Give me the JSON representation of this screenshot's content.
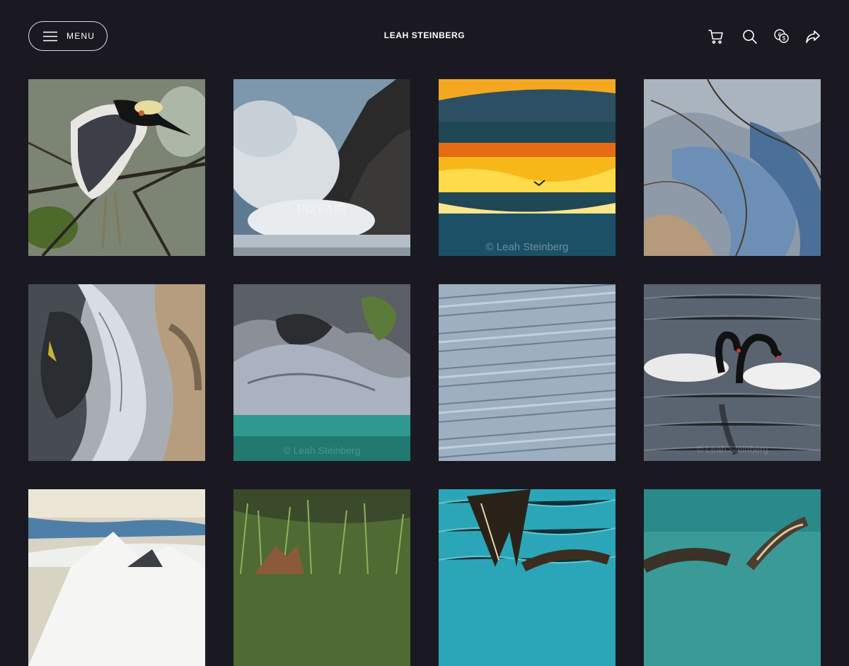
{
  "header": {
    "menu_label": "MENU",
    "site_title": "LEAH STEINBERG",
    "icons": [
      "cart-icon",
      "search-icon",
      "currency-icon",
      "share-icon"
    ]
  },
  "gallery": {
    "tiles": [
      {
        "subject": "night heron on branches",
        "watermark": ""
      },
      {
        "subject": "wave crashing on rock",
        "watermark": "PIXFAIR"
      },
      {
        "subject": "sunset with bird",
        "watermark": "© Leah Steinberg"
      },
      {
        "subject": "marble rock texture",
        "watermark": ""
      },
      {
        "subject": "marble cave arch",
        "watermark": ""
      },
      {
        "subject": "marble caves over turquoise water",
        "watermark": "© Leah Steinberg"
      },
      {
        "subject": "glacier crevasses",
        "watermark": ""
      },
      {
        "subject": "black-necked swans",
        "watermark": "© Leah Steinberg"
      },
      {
        "subject": "snowy mountain peaks",
        "watermark": ""
      },
      {
        "subject": "fox in grass",
        "watermark": ""
      },
      {
        "subject": "pelican wings over water",
        "watermark": ""
      },
      {
        "subject": "pelican spreading wings",
        "watermark": ""
      }
    ]
  },
  "colors": {
    "background": "#1a1922",
    "text": "#ffffff",
    "border": "#d9d9df"
  }
}
